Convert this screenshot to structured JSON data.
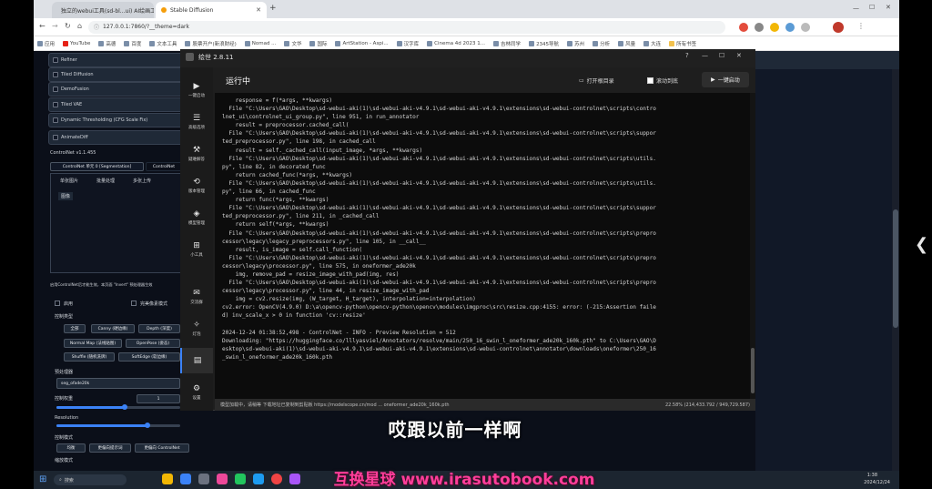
{
  "browser": {
    "tabs": [
      {
        "label": "独立的webui工具(sd-bl...ui) AI绘画工...",
        "active": false
      },
      {
        "label": "Stable Diffusion",
        "active": true
      }
    ],
    "new_tab": "+",
    "url": "127.0.0.1:7860/?__theme=dark",
    "bookmarks": [
      "应用",
      "YouTube",
      "高德",
      "百度",
      "文本工具",
      "股票开户(新浪财经)",
      "Nomad ...",
      "文华",
      "国际",
      "ArtStation - Aspi...",
      "汉字库",
      "Cinema 4d 2023 1...",
      "吉林同学",
      "2345导航",
      "苏州",
      "分析",
      "风量",
      "大连",
      "所有书签"
    ]
  },
  "webui": {
    "checkboxes": [
      "Refiner",
      "Tiled Diffusion",
      "DemoFusion",
      "Tiled VAE",
      "Dynamic Thresholding (CFG Scale Fix)",
      "AnimateDiff"
    ],
    "controlnet_title": "ControlNet v1.1.455",
    "unit_tab": "ControlNet 单元 0 [Segmentation]",
    "unit_tab2": "ControlNet",
    "image_tabs": [
      "单张图片",
      "批量处理",
      "多张上传"
    ],
    "image_label": "图像",
    "note": "启用ControlNet后才能生效，本页面 \"Invert\" 预处理器生效",
    "enable": "启用",
    "perfect_pixel": "完美像素模式",
    "control_type_label": "控制类型",
    "control_types": [
      "全部",
      "Canny (硬边缘)",
      "Depth (深度)",
      "Normal Map (法线贴图)",
      "OpenPose (姿态)",
      "Shuffle (随机洗牌)",
      "SoftEdge (软边缘)"
    ],
    "preprocessor_label": "预处理器",
    "preprocessor_value": "seg_ofade20k",
    "control_weight_label": "控制权重",
    "control_weight_value": "1",
    "resolution_label": "Resolution",
    "control_mode_label": "控制模式",
    "control_modes": [
      "均衡",
      "更偏向提示词",
      "更偏向 ControlNet"
    ],
    "resize_label": "缩放模式"
  },
  "launcher": {
    "title": "绘世 2.8.11",
    "controls": [
      "?",
      "—",
      "☐",
      "✕"
    ],
    "sidebar": [
      {
        "icon": "play-icon",
        "glyph": "▶",
        "label": "一键启动"
      },
      {
        "icon": "sliders-icon",
        "glyph": "☰",
        "label": "高级选项"
      },
      {
        "icon": "wrench-icon",
        "glyph": "⚒",
        "label": "疑难解答"
      },
      {
        "icon": "history-icon",
        "glyph": "⟲",
        "label": "版本管理"
      },
      {
        "icon": "cube-icon",
        "glyph": "◈",
        "label": "模型管理"
      },
      {
        "icon": "toolbox-icon",
        "glyph": "⊞",
        "label": "小工具"
      },
      {
        "icon": "chat-icon",
        "glyph": "✉",
        "label": "交流群"
      },
      {
        "icon": "bulb-icon",
        "glyph": "✧",
        "label": "灯泡"
      },
      {
        "icon": "console-icon",
        "glyph": "▤",
        "label": ""
      },
      {
        "icon": "settings-icon",
        "glyph": "⚙",
        "label": "设置"
      }
    ],
    "status_title": "运行中",
    "toolbar": {
      "open_folder": "打开根目录",
      "auto_scroll": "滚动到底",
      "stop": "一键启动"
    },
    "console_lines": [
      "    response = f(*args, **kwargs)",
      "  File \"C:\\Users\\GAO\\Desktop\\sd-webui-aki(1)\\sd-webui-aki-v4.9.1\\sd-webui-aki-v4.9.1\\extensions\\sd-webui-controlnet\\scripts\\contro",
      "lnet_ui\\controlnet_ui_group.py\", line 951, in run_annotator",
      "    result = preprocessor.cached_call(",
      "  File \"C:\\Users\\GAO\\Desktop\\sd-webui-aki(1)\\sd-webui-aki-v4.9.1\\sd-webui-aki-v4.9.1\\extensions\\sd-webui-controlnet\\scripts\\suppor",
      "ted_preprocessor.py\", line 198, in cached_call",
      "    result = self._cached_call(input_image, *args, **kwargs)",
      "  File \"C:\\Users\\GAO\\Desktop\\sd-webui-aki(1)\\sd-webui-aki-v4.9.1\\sd-webui-aki-v4.9.1\\extensions\\sd-webui-controlnet\\scripts\\utils.",
      "py\", line 82, in decorated_func",
      "    return cached_func(*args, **kwargs)",
      "  File \"C:\\Users\\GAO\\Desktop\\sd-webui-aki(1)\\sd-webui-aki-v4.9.1\\sd-webui-aki-v4.9.1\\extensions\\sd-webui-controlnet\\scripts\\utils.",
      "py\", line 66, in cached_func",
      "    return func(*args, **kwargs)",
      "  File \"C:\\Users\\GAO\\Desktop\\sd-webui-aki(1)\\sd-webui-aki-v4.9.1\\sd-webui-aki-v4.9.1\\extensions\\sd-webui-controlnet\\scripts\\suppor",
      "ted_preprocessor.py\", line 211, in _cached_call",
      "    return self(*args, **kwargs)",
      "  File \"C:\\Users\\GAO\\Desktop\\sd-webui-aki(1)\\sd-webui-aki-v4.9.1\\sd-webui-aki-v4.9.1\\extensions\\sd-webui-controlnet\\scripts\\prepro",
      "cessor\\legacy\\legacy_preprocessors.py\", line 105, in __call__",
      "    result, is_image = self.call_function(",
      "  File \"C:\\Users\\GAO\\Desktop\\sd-webui-aki(1)\\sd-webui-aki-v4.9.1\\sd-webui-aki-v4.9.1\\extensions\\sd-webui-controlnet\\scripts\\prepro",
      "cessor\\legacy\\processor.py\", line 575, in oneformer_ade20k",
      "    img, remove_pad = resize_image_with_pad(img, res)",
      "  File \"C:\\Users\\GAO\\Desktop\\sd-webui-aki(1)\\sd-webui-aki-v4.9.1\\sd-webui-aki-v4.9.1\\extensions\\sd-webui-controlnet\\scripts\\prepro",
      "cessor\\legacy\\processor.py\", line 44, in resize_image_with_pad",
      "    img = cv2.resize(img, (W_target, H_target), interpolation=interpolation)",
      "cv2.error: OpenCV(4.9.0) D:\\a\\opencv-python\\opencv-python\\opencv\\modules\\imgproc\\src\\resize.cpp:4155: error: (-215:Assertion faile",
      "d) inv_scale_x > 0 in function 'cv::resize'",
      "",
      "2024-12-24 01:38:52,498 - ControlNet - INFO - Preview Resolution = 512",
      "Downloading: \"https://huggingface.co/lllyasviel/Annotators/resolve/main/250_16_swin_l_oneformer_ade20k_160k.pth\" to C:\\Users\\GAO\\D",
      "esktop\\sd-webui-aki(1)\\sd-webui-aki-v4.9.1\\sd-webui-aki-v4.9.1\\extensions\\sd-webui-controlnet\\annotator\\downloads\\oneformer\\250_16",
      "_swin_l_oneformer_ade20k_160k.pth"
    ],
    "statusbar_left": "模型加载中，请稍等  下载地址已复制到剪贴板 https://modelscope.cn/mod ...  oneformer_ade20k_160k.pth",
    "statusbar_right": "22.58%  (214,433.792 / 949,729.587)"
  },
  "subtitle_main": "哎跟以前一样啊",
  "watermark": "互换星球 www.irasutobook.com",
  "taskbar": {
    "search": "搜索",
    "time": "1:38",
    "date": "2024/12/24"
  },
  "colors": {
    "accent": "#3b82f6",
    "watermark": "#ff3e9a",
    "console_bg": "#0c0c0c",
    "page_bg": "#0b0f19"
  }
}
